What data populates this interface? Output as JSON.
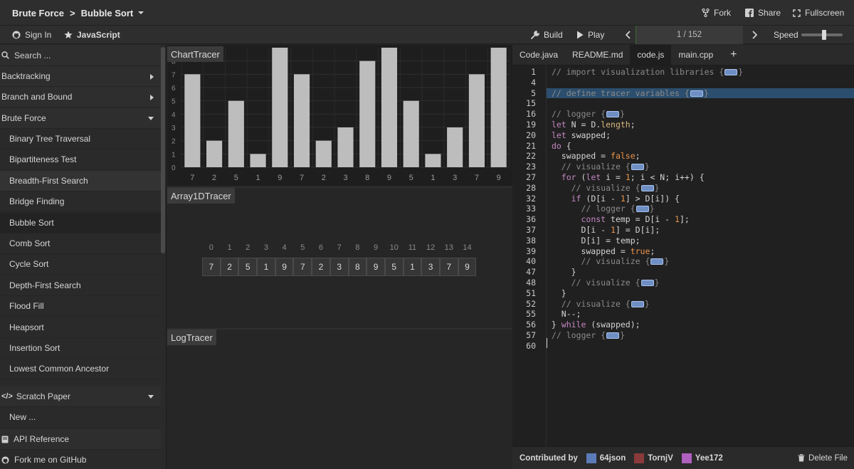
{
  "topbar": {
    "breadcrumb_category": "Brute Force",
    "breadcrumb_separator": ">",
    "breadcrumb_algorithm": "Bubble Sort",
    "fork_label": "Fork",
    "share_label": "Share",
    "fullscreen_label": "Fullscreen"
  },
  "bar2": {
    "signin_label": "Sign In",
    "language_label": "JavaScript",
    "build_label": "Build",
    "play_label": "Play",
    "step_label": "1 / 152",
    "step_progress": 0.0066,
    "speed_label": "Speed",
    "speed_value": 0.55
  },
  "sidebar": {
    "search_placeholder": "Search ...",
    "categories": [
      {
        "label": "Backtracking",
        "state": "collapsed"
      },
      {
        "label": "Branch and Bound",
        "state": "collapsed"
      },
      {
        "label": "Brute Force",
        "state": "expanded"
      }
    ],
    "items": [
      "Binary Tree Traversal",
      "Bipartiteness Test",
      "Breadth-First Search",
      "Bridge Finding",
      "Bubble Sort",
      "Comb Sort",
      "Cycle Sort",
      "Depth-First Search",
      "Flood Fill",
      "Heapsort",
      "Insertion Sort",
      "Lowest Common Ancestor"
    ],
    "scratch_paper_label": "Scratch Paper",
    "new_label": "New ...",
    "api_reference_label": "API Reference",
    "github_label": "Fork me on GitHub"
  },
  "panels": {
    "chart_tracer_label": "ChartTracer",
    "array_tracer_label": "Array1DTracer",
    "log_tracer_label": "LogTracer"
  },
  "chart_data": {
    "type": "bar",
    "categories": [
      "7",
      "2",
      "5",
      "1",
      "9",
      "7",
      "2",
      "3",
      "8",
      "9",
      "5",
      "1",
      "3",
      "7",
      "9"
    ],
    "values": [
      7,
      2,
      5,
      1,
      9,
      7,
      2,
      3,
      8,
      9,
      5,
      1,
      3,
      7,
      9
    ],
    "title": "",
    "xlabel": "",
    "ylabel": "",
    "ylim": [
      0,
      9
    ],
    "yticks": [
      "0",
      "1",
      "2",
      "3",
      "4",
      "5",
      "6",
      "7",
      "8"
    ],
    "grid": true,
    "bar_color": "#bdbdbd"
  },
  "array": {
    "indices": [
      "0",
      "1",
      "2",
      "3",
      "4",
      "5",
      "6",
      "7",
      "8",
      "9",
      "10",
      "11",
      "12",
      "13",
      "14"
    ],
    "values": [
      "7",
      "2",
      "5",
      "1",
      "9",
      "7",
      "2",
      "3",
      "8",
      "9",
      "5",
      "1",
      "3",
      "7",
      "9"
    ]
  },
  "editor": {
    "tabs": [
      "Code.java",
      "README.md",
      "code.js",
      "main.cpp"
    ],
    "active_tab": "code.js",
    "add_tab_label": "+",
    "highlight_line": "5",
    "lines": [
      {
        "n": "1",
        "t": "// import visualization libraries {",
        "fold": true
      },
      {
        "n": "4",
        "t": ""
      },
      {
        "n": "5",
        "t": "// define tracer variables {",
        "fold": true
      },
      {
        "n": "15",
        "t": ""
      },
      {
        "n": "16",
        "t": "// logger {",
        "fold": true
      },
      {
        "n": "19",
        "t": "let N = D.length;"
      },
      {
        "n": "20",
        "t": "let swapped;"
      },
      {
        "n": "21",
        "t": "do {"
      },
      {
        "n": "22",
        "t": "  swapped = false;"
      },
      {
        "n": "23",
        "t": "  // visualize {",
        "fold": true
      },
      {
        "n": "27",
        "t": "  for (let i = 1; i < N; i++) {"
      },
      {
        "n": "28",
        "t": "    // visualize {",
        "fold": true
      },
      {
        "n": "32",
        "t": "    if (D[i - 1] > D[i]) {"
      },
      {
        "n": "33",
        "t": "      // logger {",
        "fold": true
      },
      {
        "n": "36",
        "t": "      const temp = D[i - 1];"
      },
      {
        "n": "37",
        "t": "      D[i - 1] = D[i];"
      },
      {
        "n": "38",
        "t": "      D[i] = temp;"
      },
      {
        "n": "39",
        "t": "      swapped = true;"
      },
      {
        "n": "40",
        "t": "      // visualize {",
        "fold": true
      },
      {
        "n": "47",
        "t": "    }"
      },
      {
        "n": "48",
        "t": "    // visualize {",
        "fold": true
      },
      {
        "n": "51",
        "t": "  }"
      },
      {
        "n": "52",
        "t": "  // visualize {",
        "fold": true
      },
      {
        "n": "55",
        "t": "  N--;"
      },
      {
        "n": "56",
        "t": "} while (swapped);"
      },
      {
        "n": "57",
        "t": "// logger {",
        "fold": true
      },
      {
        "n": "60",
        "t": ""
      }
    ]
  },
  "footer": {
    "contributed_label": "Contributed by",
    "contributors": [
      "64json",
      "TornjV",
      "Yee172"
    ],
    "delete_label": "Delete File"
  },
  "colors": {
    "accent_highlight": "#2c4e6e",
    "progress_fill": "#3a6b2e",
    "fold_marker": "#6f8fc4"
  }
}
